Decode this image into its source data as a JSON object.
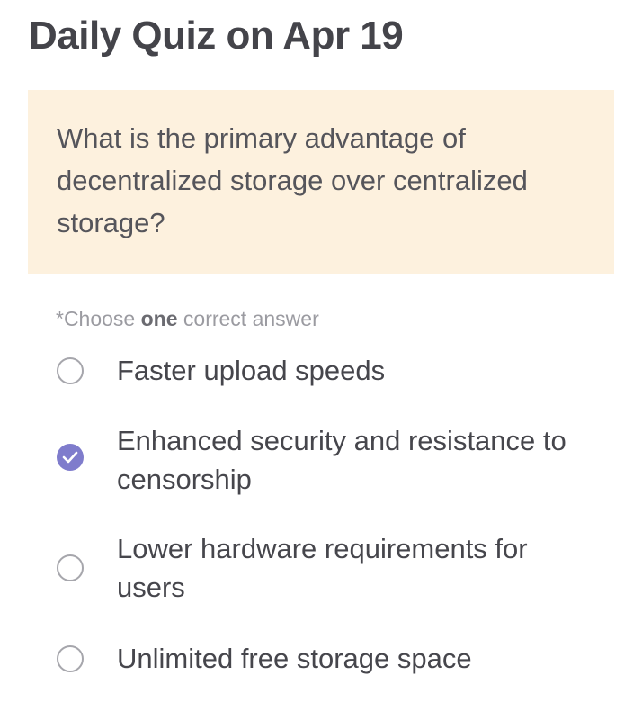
{
  "header": {
    "title": "Daily Quiz on Apr 19"
  },
  "question": {
    "text": "What is the primary advantage of decentralized storage over centralized storage?"
  },
  "instruction": {
    "prefix": "*Choose ",
    "emphasis": "one",
    "suffix": " correct answer"
  },
  "options": [
    {
      "label": "Faster upload speeds",
      "selected": false
    },
    {
      "label": "Enhanced security and resistance to censorship",
      "selected": true
    },
    {
      "label": "Lower hardware requirements for users",
      "selected": false
    },
    {
      "label": "Unlimited free storage space",
      "selected": false
    }
  ],
  "colors": {
    "accent": "#7f7ccc",
    "card_background": "#fdf1de",
    "radio_border": "#a6a6ac"
  },
  "icons": {
    "unselected": "radio-unchecked-icon",
    "selected": "check-circle-icon"
  }
}
